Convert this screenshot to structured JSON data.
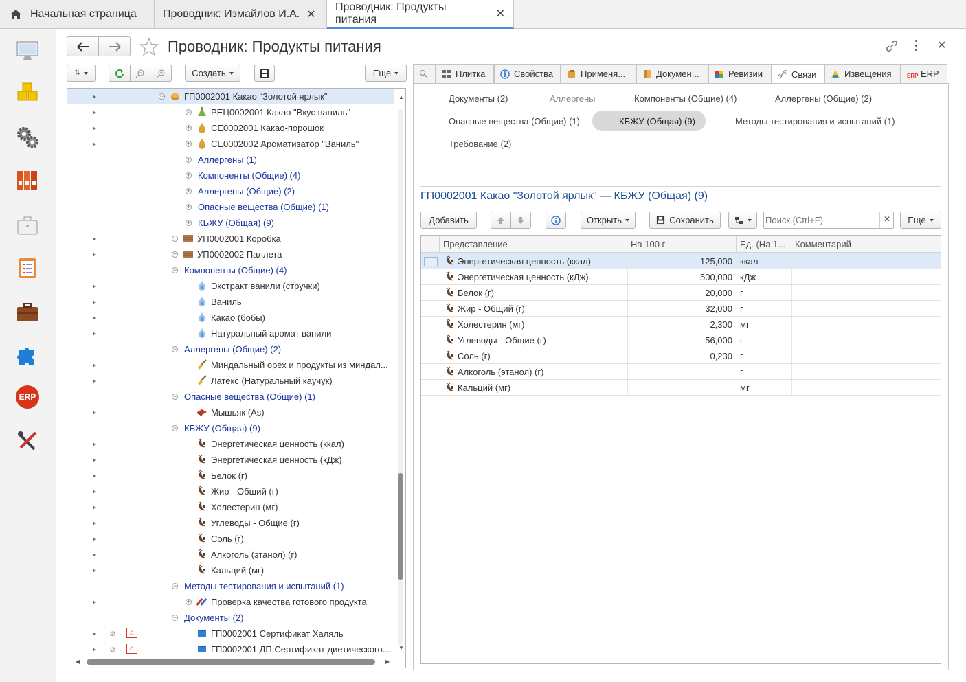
{
  "top_tabs": [
    {
      "label": "Начальная страница"
    },
    {
      "label": "Проводник: Измайлов И.А."
    },
    {
      "label": "Проводник: Продукты питания"
    }
  ],
  "window": {
    "title": "Проводник: Продукты питания"
  },
  "toolbar": {
    "create": "Создать",
    "more": "Еще"
  },
  "tree": [
    {
      "label": "ГП0002001 Какао \"Золотой ярлык\"",
      "blue": false
    },
    {
      "label": "РЕЦ0002001 Какао \"Вкус ваниль\"",
      "blue": false
    },
    {
      "label": "СЕ0002001 Какао-порошок",
      "blue": false
    },
    {
      "label": "СЕ0002002 Ароматизатор \"Ваниль\"",
      "blue": false
    },
    {
      "label": "Аллергены (1)",
      "blue": true
    },
    {
      "label": "Компоненты (Общие) (4)",
      "blue": true
    },
    {
      "label": "Аллергены (Общие) (2)",
      "blue": true
    },
    {
      "label": "Опасные вещества (Общие) (1)",
      "blue": true
    },
    {
      "label": "КБЖУ (Общая) (9)",
      "blue": true
    },
    {
      "label": "УП0002001 Коробка",
      "blue": false
    },
    {
      "label": "УП0002002 Паллета",
      "blue": false
    },
    {
      "label": "Компоненты (Общие) (4)",
      "blue": true
    },
    {
      "label": "Экстракт ванили (стручки)",
      "blue": false
    },
    {
      "label": "Ваниль",
      "blue": false
    },
    {
      "label": "Какао (бобы)",
      "blue": false
    },
    {
      "label": "Натуральный аромат ванили",
      "blue": false
    },
    {
      "label": "Аллергены (Общие) (2)",
      "blue": true
    },
    {
      "label": "Миндальный орех и продукты из миндал...",
      "blue": false
    },
    {
      "label": "Латекс (Натуральный каучук)",
      "blue": false
    },
    {
      "label": "Опасные вещества (Общие) (1)",
      "blue": true
    },
    {
      "label": "Мышьяк (As)",
      "blue": false
    },
    {
      "label": "КБЖУ (Общая) (9)",
      "blue": true
    },
    {
      "label": "Энергетическая ценность (ккал)",
      "blue": false
    },
    {
      "label": "Энергетическая ценность (кДж)",
      "blue": false
    },
    {
      "label": "Белок (г)",
      "blue": false
    },
    {
      "label": "Жир - Общий (г)",
      "blue": false
    },
    {
      "label": "Холестерин (мг)",
      "blue": false
    },
    {
      "label": "Углеводы - Общие (г)",
      "blue": false
    },
    {
      "label": "Соль (г)",
      "blue": false
    },
    {
      "label": "Алкоголь (этанол) (г)",
      "blue": false
    },
    {
      "label": "Кальций (мг)",
      "blue": false
    },
    {
      "label": "Методы тестирования и испытаний (1)",
      "blue": true
    },
    {
      "label": "Проверка качества готового продукта",
      "blue": false
    },
    {
      "label": "Документы  (2)",
      "blue": true
    },
    {
      "label": "ГП0002001 Сертификат Халяль",
      "blue": false
    },
    {
      "label": "ГП0002001 ДП Сертификат диетического...",
      "blue": false
    }
  ],
  "right_tabs": [
    {
      "label": ""
    },
    {
      "label": "Плитка"
    },
    {
      "label": "Свойства"
    },
    {
      "label": "Применя..."
    },
    {
      "label": "Докумен..."
    },
    {
      "label": "Ревизии"
    },
    {
      "label": "Связи"
    },
    {
      "label": "Извещения"
    },
    {
      "label": "ERP"
    }
  ],
  "links": [
    {
      "label": "Документы  (2)"
    },
    {
      "label": "Аллергены"
    },
    {
      "label": "Компоненты (Общие) (4)"
    },
    {
      "label": "Аллергены (Общие) (2)"
    },
    {
      "label": "Опасные вещества (Общие) (1)"
    },
    {
      "label": "КБЖУ (Общая) (9)"
    },
    {
      "label": "Методы тестирования и испытаний (1)"
    },
    {
      "label": "Требование (2)"
    }
  ],
  "section": {
    "title": "ГП0002001 Какао \"Золотой ярлык\" — КБЖУ (Общая) (9)"
  },
  "grid_toolbar": {
    "add": "Добавить",
    "open": "Открыть",
    "save": "Сохранить",
    "search_placeholder": "Поиск (Ctrl+F)",
    "more": "Еще"
  },
  "grid": {
    "columns": [
      "Представление",
      "На 100 г",
      "Ед. (На 1...",
      "Комментарий"
    ],
    "rows": [
      {
        "name": "Энергетическая ценность (ккал)",
        "value": "125,000",
        "unit": "ккал"
      },
      {
        "name": "Энергетическая ценность (кДж)",
        "value": "500,000",
        "unit": "кДж"
      },
      {
        "name": "Белок (г)",
        "value": "20,000",
        "unit": "г"
      },
      {
        "name": "Жир - Общий (г)",
        "value": "32,000",
        "unit": "г"
      },
      {
        "name": "Холестерин (мг)",
        "value": "2,300",
        "unit": "мг"
      },
      {
        "name": "Углеводы - Общие (г)",
        "value": "56,000",
        "unit": "г"
      },
      {
        "name": "Соль (г)",
        "value": "0,230",
        "unit": "г"
      },
      {
        "name": "Алкоголь (этанол) (г)",
        "value": "",
        "unit": "г"
      },
      {
        "name": "Кальций (мг)",
        "value": "",
        "unit": "мг"
      }
    ]
  },
  "sidebar": {
    "erp_label": "ERP"
  }
}
